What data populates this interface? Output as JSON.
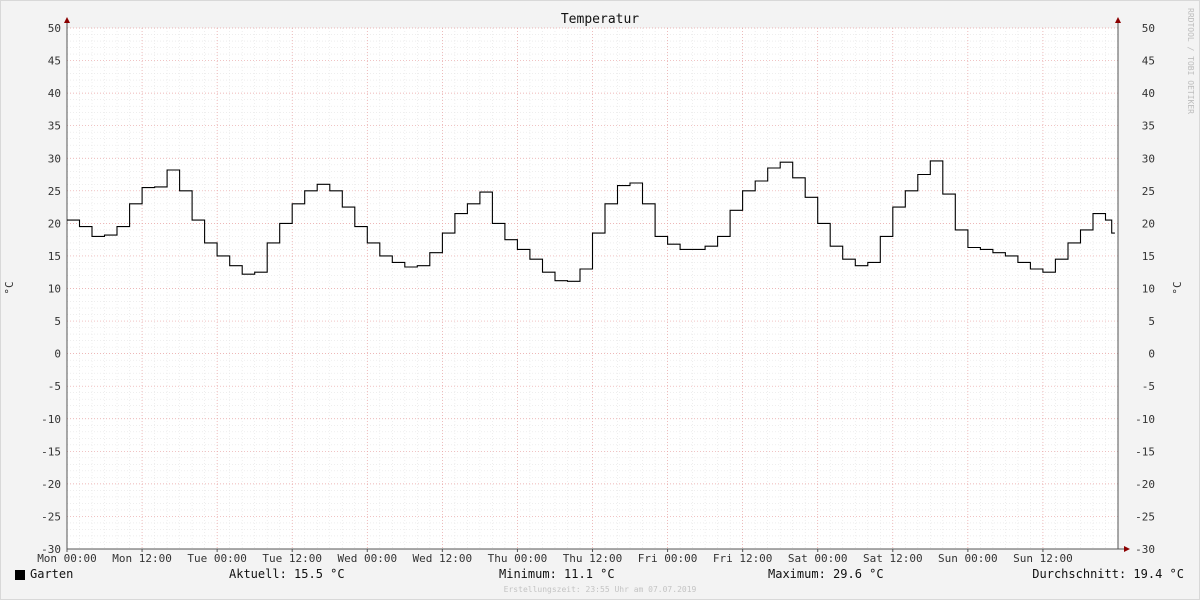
{
  "chart_data": {
    "type": "line",
    "title": "Temperatur",
    "ylabel": "°C",
    "ylabel_right": "°C",
    "ylim": [
      -30,
      50
    ],
    "y_ticks": [
      50,
      45,
      40,
      35,
      30,
      25,
      20,
      15,
      10,
      5,
      0,
      -5,
      -10,
      -15,
      -20,
      -25,
      -30
    ],
    "x_ticks": [
      "Mon 00:00",
      "Mon 12:00",
      "Tue 00:00",
      "Tue 12:00",
      "Wed 00:00",
      "Wed 12:00",
      "Thu 00:00",
      "Thu 12:00",
      "Fri 00:00",
      "Fri 12:00",
      "Sat 00:00",
      "Sat 12:00",
      "Sun 00:00",
      "Sun 12:00"
    ],
    "x_unit": "hours since Mon 00:00",
    "grid": true,
    "series": [
      {
        "name": "Garten",
        "color": "#000000",
        "x": [
          0,
          2,
          4,
          6,
          8,
          10,
          12,
          14,
          16,
          18,
          20,
          22,
          24,
          26,
          28,
          30,
          32,
          34,
          36,
          38,
          40,
          42,
          44,
          46,
          48,
          50,
          52,
          54,
          56,
          58,
          60,
          62,
          64,
          66,
          68,
          70,
          72,
          74,
          76,
          78,
          80,
          82,
          84,
          86,
          88,
          90,
          92,
          94,
          96,
          98,
          100,
          102,
          104,
          106,
          108,
          110,
          112,
          114,
          116,
          118,
          120,
          122,
          124,
          126,
          128,
          130,
          132,
          134,
          136,
          138,
          140,
          142,
          144,
          146,
          148,
          150,
          152,
          154,
          156,
          158,
          160,
          162,
          164,
          166,
          167
        ],
        "values": [
          20.5,
          19.5,
          18.0,
          18.2,
          19.5,
          23.0,
          25.5,
          25.6,
          28.2,
          25.0,
          20.5,
          17.0,
          15.0,
          13.5,
          12.2,
          12.5,
          17.0,
          20.0,
          23.0,
          25.0,
          26.0,
          25.0,
          22.5,
          19.5,
          17.0,
          15.0,
          14.0,
          13.3,
          13.5,
          15.5,
          18.5,
          21.5,
          23.0,
          24.8,
          20.0,
          17.5,
          16.0,
          14.5,
          12.5,
          11.2,
          11.1,
          13.0,
          18.5,
          23.0,
          25.8,
          26.2,
          23.0,
          18.0,
          16.8,
          16.0,
          16.0,
          16.5,
          18.0,
          22.0,
          25.0,
          26.5,
          28.5,
          29.4,
          27.0,
          24.0,
          20.0,
          16.5,
          14.5,
          13.5,
          14.0,
          18.0,
          22.5,
          25.0,
          27.5,
          29.6,
          24.5,
          19.0,
          16.3,
          16.0,
          15.5,
          15.0,
          14.0,
          13.0,
          12.5,
          14.5,
          17.0,
          19.0,
          21.5,
          20.5,
          18.5
        ]
      }
    ]
  },
  "watermark": "RRDTOOL / TOBI OETIKER",
  "footer": {
    "legend_label": "Garten",
    "current": "Aktuell: 15.5 °C",
    "minimum": "Minimum: 11.1 °C",
    "maximum": "Maximum: 29.6 °C",
    "average": "Durchschnitt: 19.4 °C",
    "created": "Erstellungszeit: 23:55 Uhr am 07.07.2019"
  }
}
